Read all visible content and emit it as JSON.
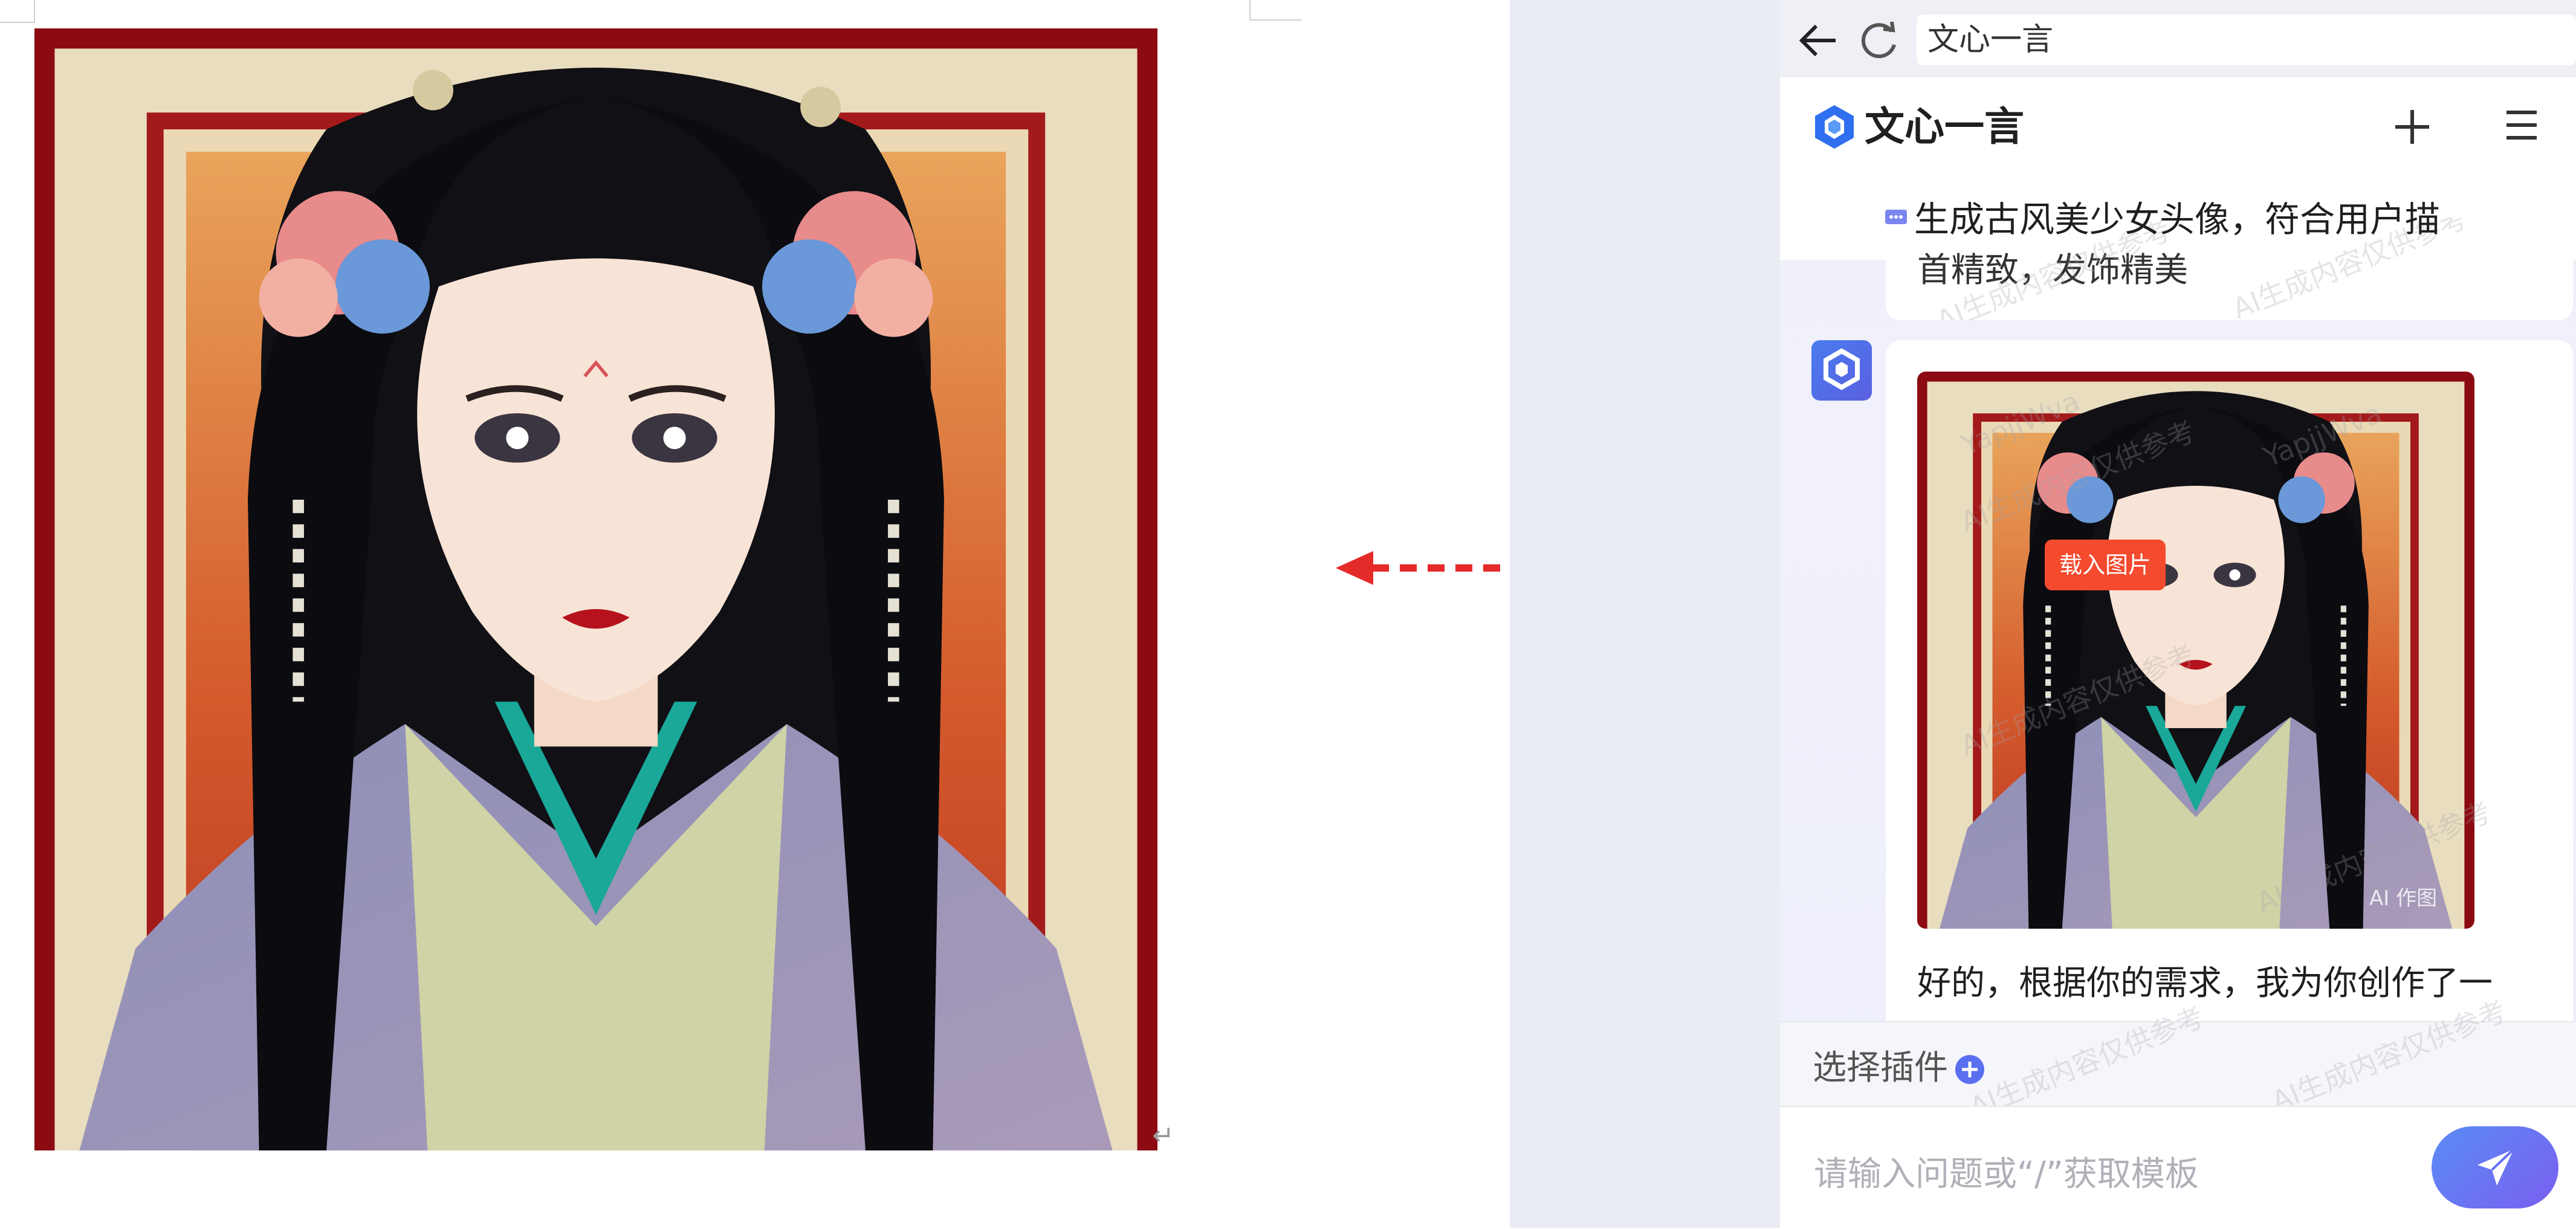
{
  "browser": {
    "address": "文心一言"
  },
  "app": {
    "title": "文心一言"
  },
  "conversation": {
    "user_prompt": "生成古风美少女头像，符合用户描",
    "user_prompt_tail": "首精致，发饰精美",
    "bot_reply": "好的，根据你的需求，我为你创作了一",
    "image_badge": "AI 作图",
    "watermark_id": "YapjjWva",
    "watermark_note": "AI生成内容仅供参考"
  },
  "overlay": {
    "load_button": "载入图片"
  },
  "plugins": {
    "label": "选择插件"
  },
  "composer": {
    "placeholder": "请输入问题或“/”获取模板"
  },
  "colors": {
    "accent": "#5a6ff0",
    "arrow": "#e52a2a",
    "load_button": "#f44a2e"
  }
}
